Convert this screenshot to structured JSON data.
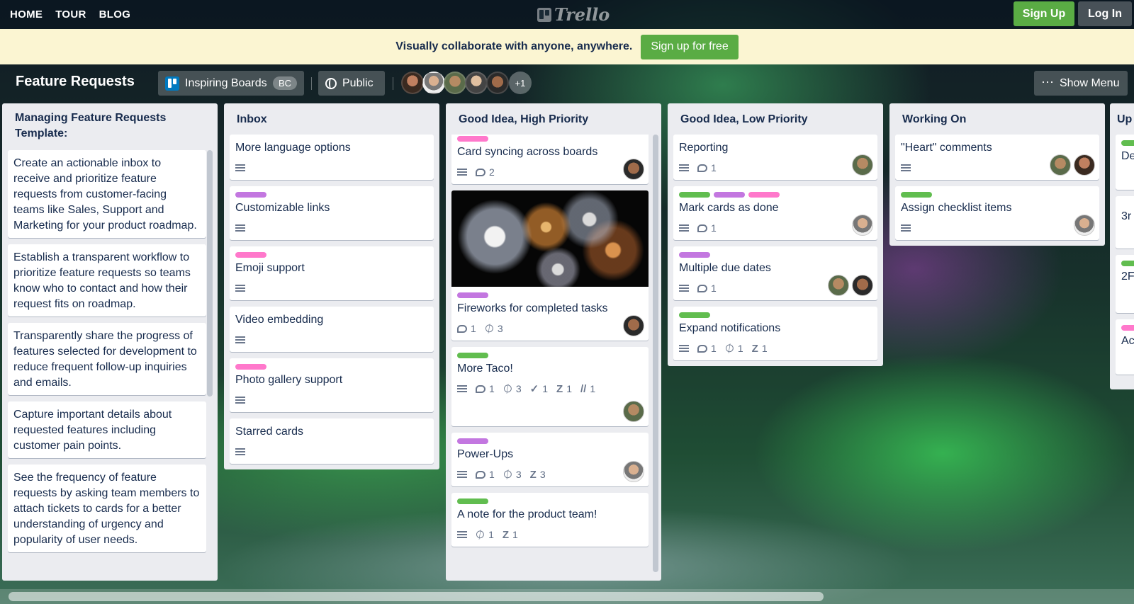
{
  "nav": {
    "links": [
      "HOME",
      "TOUR",
      "BLOG"
    ],
    "logo_text": "Trello",
    "signup_label": "Sign Up",
    "login_label": "Log In"
  },
  "banner": {
    "text": "Visually collaborate with anyone, anywhere.",
    "cta_label": "Sign up for free"
  },
  "board": {
    "title": "Feature Requests",
    "team_button_label": "Inspiring Boards",
    "team_badge": "BC",
    "visibility_label": "Public",
    "extra_members": "+1",
    "show_menu_label": "Show Menu"
  },
  "colors": {
    "green_label": "#61bd4f",
    "purple_label": "#c377e0",
    "pink_label": "#ff78cb",
    "button_green": "#5aac44",
    "list_bg": "#ebecf0"
  },
  "lists": [
    {
      "title": "Managing Feature Requests Template:",
      "cards": [
        {
          "title": "Create an actionable inbox to receive and prioritize feature requests from customer-facing teams like Sales, Support and Marketing for your product roadmap."
        },
        {
          "title": "Establish a transparent workflow to prioritize feature requests so teams know who to contact and how their request fits on roadmap."
        },
        {
          "title": "Transparently share the progress of features selected for development to reduce frequent follow-up inquiries and emails."
        },
        {
          "title": "Capture important details about requested features including customer pain points."
        },
        {
          "title": "See the frequency of feature requests by asking team members to attach tickets to cards for a better understanding of urgency and popularity of user needs."
        }
      ]
    },
    {
      "title": "Inbox",
      "cards": [
        {
          "title": "More language options",
          "labels": [],
          "badges": {
            "description": true
          }
        },
        {
          "title": "Customizable links",
          "labels": [
            "purple"
          ],
          "badges": {
            "description": true
          }
        },
        {
          "title": "Emoji support",
          "labels": [
            "pink"
          ],
          "badges": {
            "description": true
          }
        },
        {
          "title": "Video embedding",
          "labels": [],
          "badges": {
            "description": true
          }
        },
        {
          "title": "Photo gallery support",
          "labels": [
            "pink"
          ],
          "badges": {
            "description": true
          }
        },
        {
          "title": "Starred cards",
          "labels": [],
          "badges": {
            "description": true
          }
        }
      ]
    },
    {
      "title": "Good Idea, High Priority",
      "cards": [
        {
          "title": "Card syncing across boards",
          "labels": [
            "pink"
          ],
          "badges": {
            "description": true,
            "comments": "2"
          }
        },
        {
          "title": "Fireworks for completed tasks",
          "labels": [
            "purple"
          ],
          "badges": {
            "comments": "1",
            "attachments": "3"
          }
        },
        {
          "title": "More Taco!",
          "labels": [
            "green"
          ],
          "badges": {
            "description": true,
            "comments": "1",
            "attachments": "3",
            "twitter": "1",
            "zendesk": "1",
            "other": "1"
          }
        },
        {
          "title": "Power-Ups",
          "labels": [
            "purple"
          ],
          "badges": {
            "description": true,
            "comments": "1",
            "attachments": "3",
            "zendesk": "3"
          }
        },
        {
          "title": "A note for the product team!",
          "labels": [
            "green"
          ],
          "badges": {
            "description": true,
            "attachments": "1",
            "zendesk": "1"
          }
        }
      ]
    },
    {
      "title": "Good Idea, Low Priority",
      "cards": [
        {
          "title": "Reporting",
          "labels": [],
          "badges": {
            "description": true,
            "comments": "1"
          }
        },
        {
          "title": "Mark cards as done",
          "labels": [
            "green",
            "purple",
            "pink"
          ],
          "badges": {
            "description": true,
            "comments": "1"
          }
        },
        {
          "title": "Multiple due dates",
          "labels": [
            "purple"
          ],
          "badges": {
            "description": true,
            "comments": "1"
          }
        },
        {
          "title": "Expand notifications",
          "labels": [
            "green"
          ],
          "badges": {
            "description": true,
            "comments": "1",
            "attachments": "1",
            "zendesk": "1"
          }
        }
      ]
    },
    {
      "title": "Working On",
      "cards": [
        {
          "title": "\"Heart\" comments",
          "labels": [],
          "badges": {
            "description": true
          }
        },
        {
          "title": "Assign checklist items",
          "labels": [
            "green"
          ],
          "badges": {
            "description": true
          }
        }
      ]
    },
    {
      "title": "Up",
      "cards": [
        {
          "title": "De"
        },
        {
          "title": "3r"
        },
        {
          "title": "2F"
        },
        {
          "title": "Ac"
        }
      ]
    }
  ]
}
